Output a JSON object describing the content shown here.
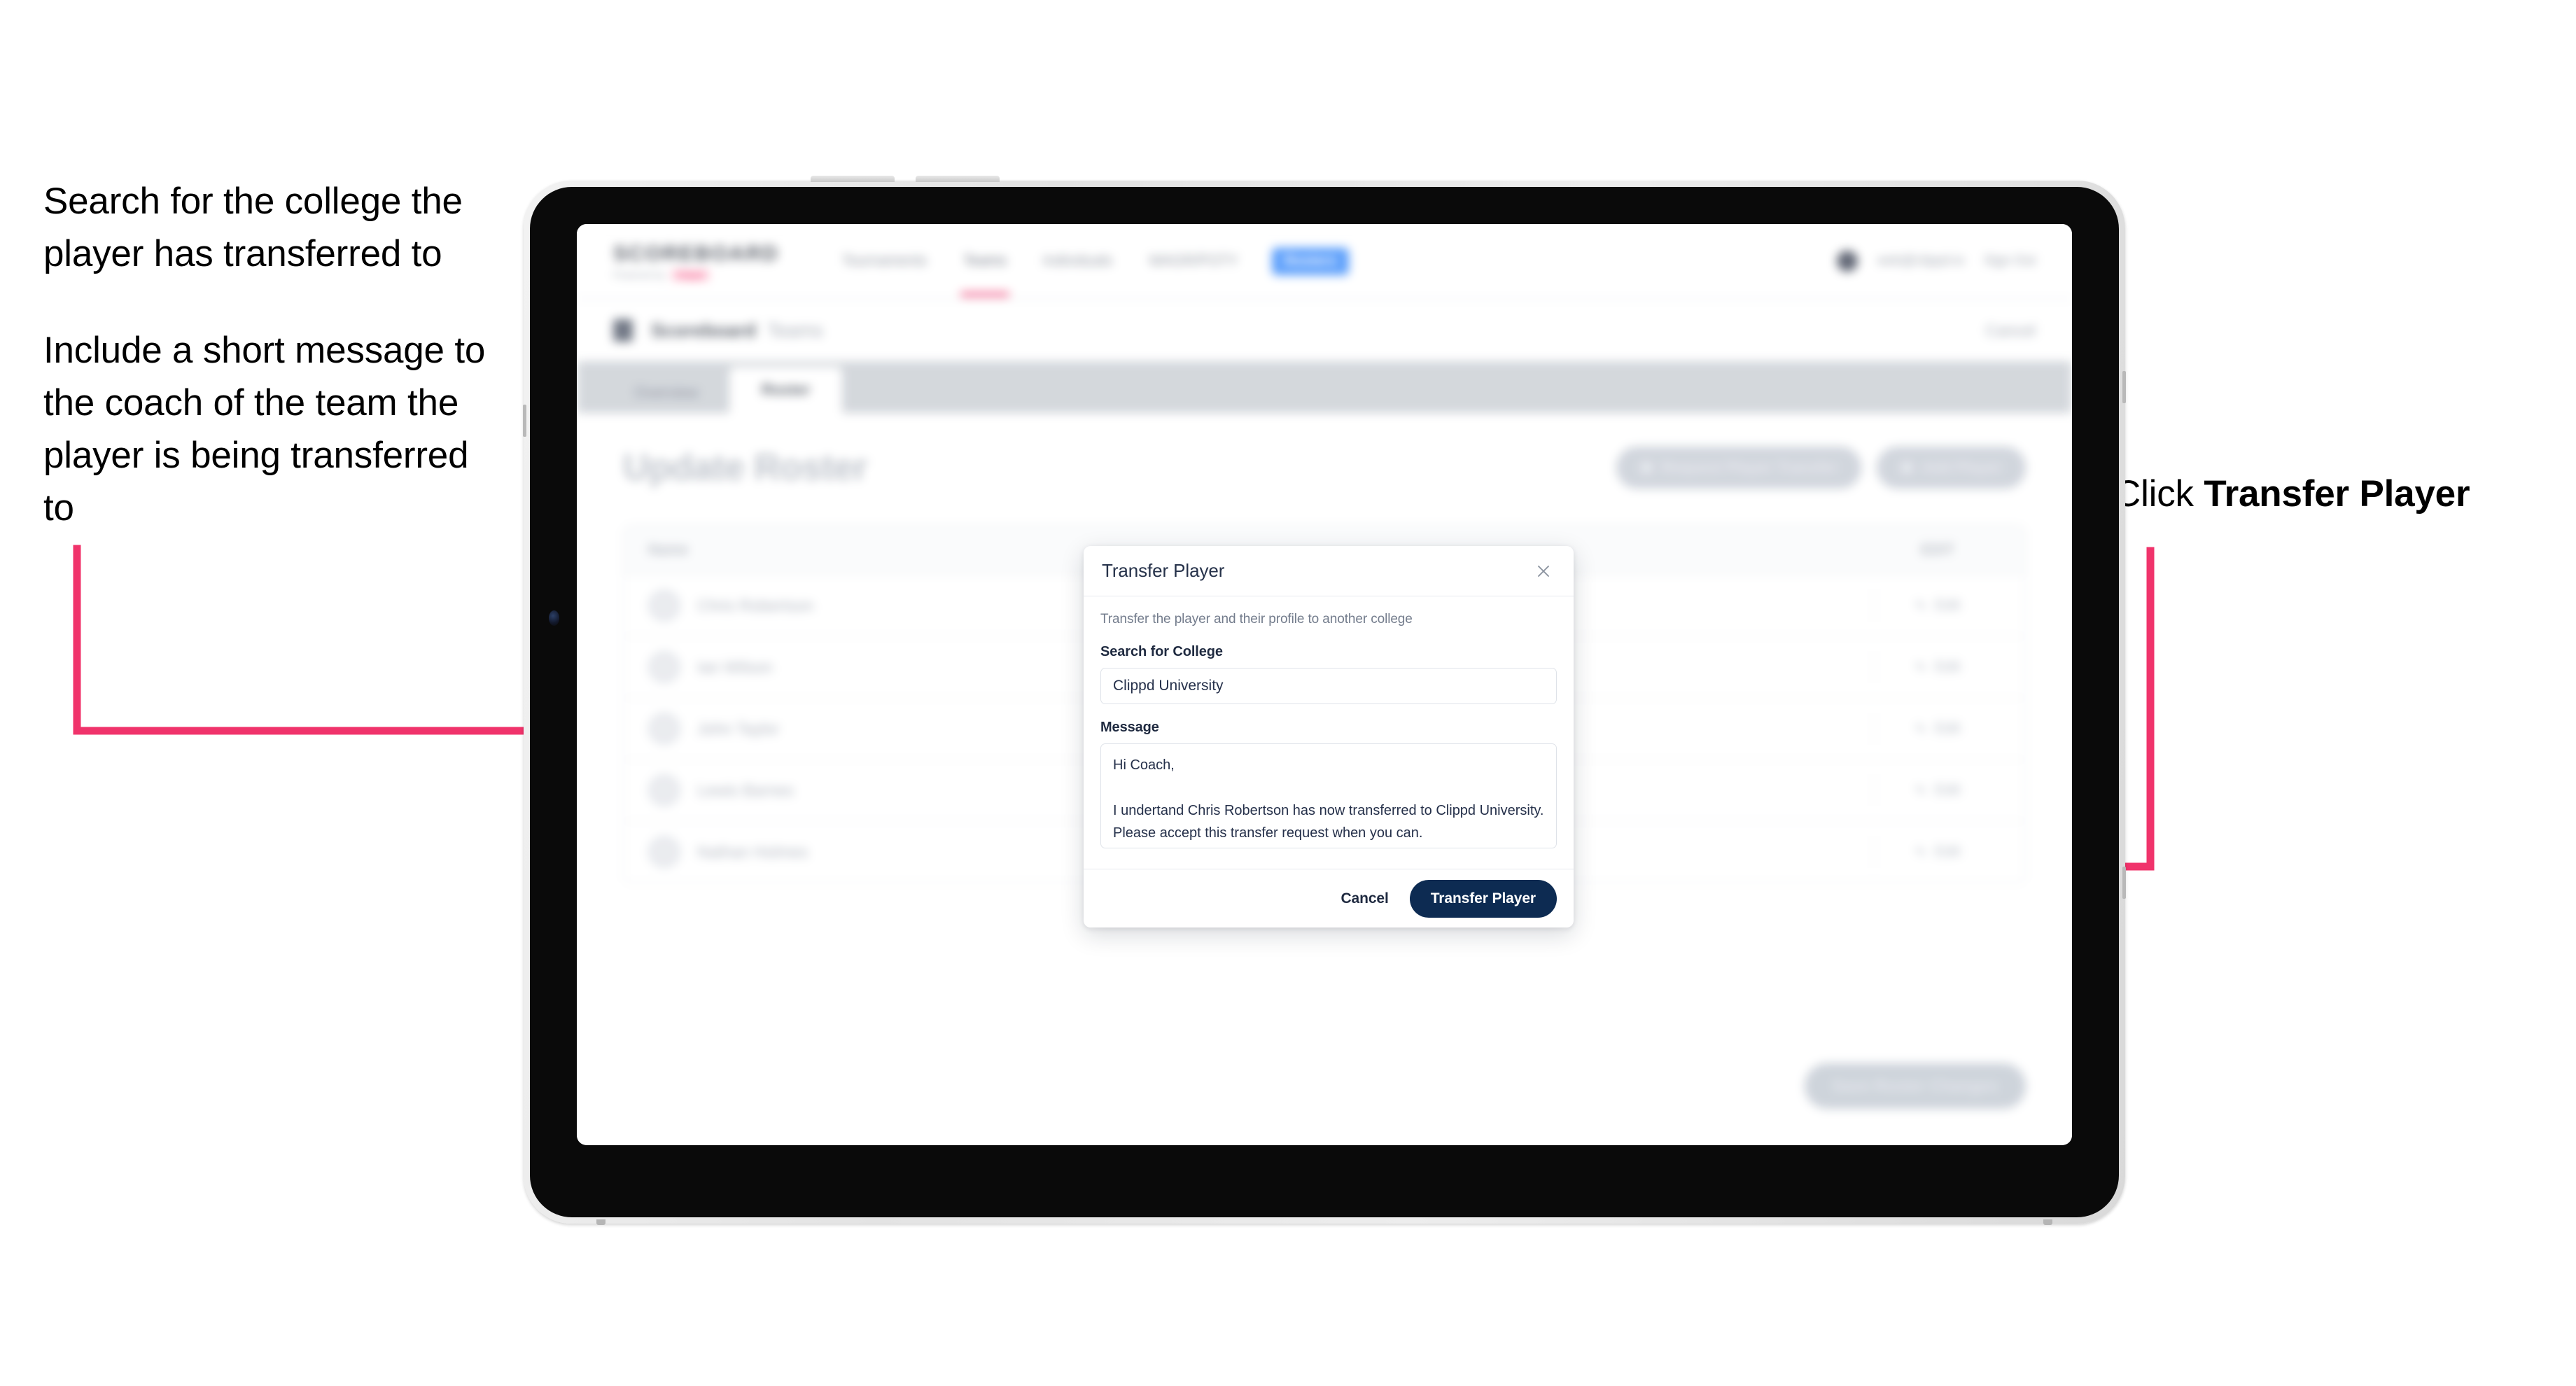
{
  "annotations": {
    "left": [
      "Search for the college the player has transferred to",
      "Include a short message to the coach of the team the player is being transferred to"
    ],
    "right_prefix": "Click ",
    "right_bold": "Transfer Player"
  },
  "colors": {
    "arrow": "#F0336B",
    "primary_button": "#0D2B52",
    "brand_accent": "#F0336B",
    "nav_pill": "#559BFB",
    "tab_bar": "#D2D6DB"
  },
  "app": {
    "brand": {
      "name": "SCOREBOARD",
      "subtitle": "Powered by",
      "chip": "Clippd"
    },
    "nav_links": [
      {
        "label": "Tournaments",
        "active": false
      },
      {
        "label": "Teams",
        "active": true
      },
      {
        "label": "Individuals",
        "active": false
      },
      {
        "label": "WAGR/POTY",
        "active": false
      }
    ],
    "nav_pill": "Rosters",
    "nav_user": "web@clippd.io",
    "nav_signout": "Sign Out",
    "breadcrumb": {
      "icon": "building-icon",
      "text": "Scoreboard",
      "team": "Teams",
      "right": "Cancel"
    },
    "tabs": [
      {
        "label": "Overview",
        "active": false
      },
      {
        "label": "Roster",
        "active": true
      }
    ],
    "page_title": "Update Roster",
    "header_actions": [
      {
        "label": "Request Player Transfer",
        "icon": "transfer-icon"
      },
      {
        "label": "Add Player",
        "icon": "plus-icon"
      }
    ],
    "roster": {
      "columns": [
        "Name",
        "EDIT"
      ],
      "rows": [
        {
          "name": "Chris Robertson",
          "action": "Edit"
        },
        {
          "name": "Ian Wilson",
          "action": "Edit"
        },
        {
          "name": "John Taylor",
          "action": "Edit"
        },
        {
          "name": "Lewis Barnes",
          "action": "Edit"
        },
        {
          "name": "Nathan Holmes",
          "action": "Edit"
        }
      ]
    },
    "bottom_cta": "Save Roster Changes"
  },
  "modal": {
    "title": "Transfer Player",
    "close_icon": "close-icon",
    "description": "Transfer the player and their profile to another college",
    "college_label": "Search for College",
    "college_value": "Clippd University",
    "college_placeholder": "Search for College",
    "message_label": "Message",
    "message_value": "Hi Coach,\n\nI undertand Chris Robertson has now transferred to Clippd University. Please accept this transfer request when you can.",
    "message_placeholder": "Message",
    "cancel_label": "Cancel",
    "submit_label": "Transfer Player"
  }
}
